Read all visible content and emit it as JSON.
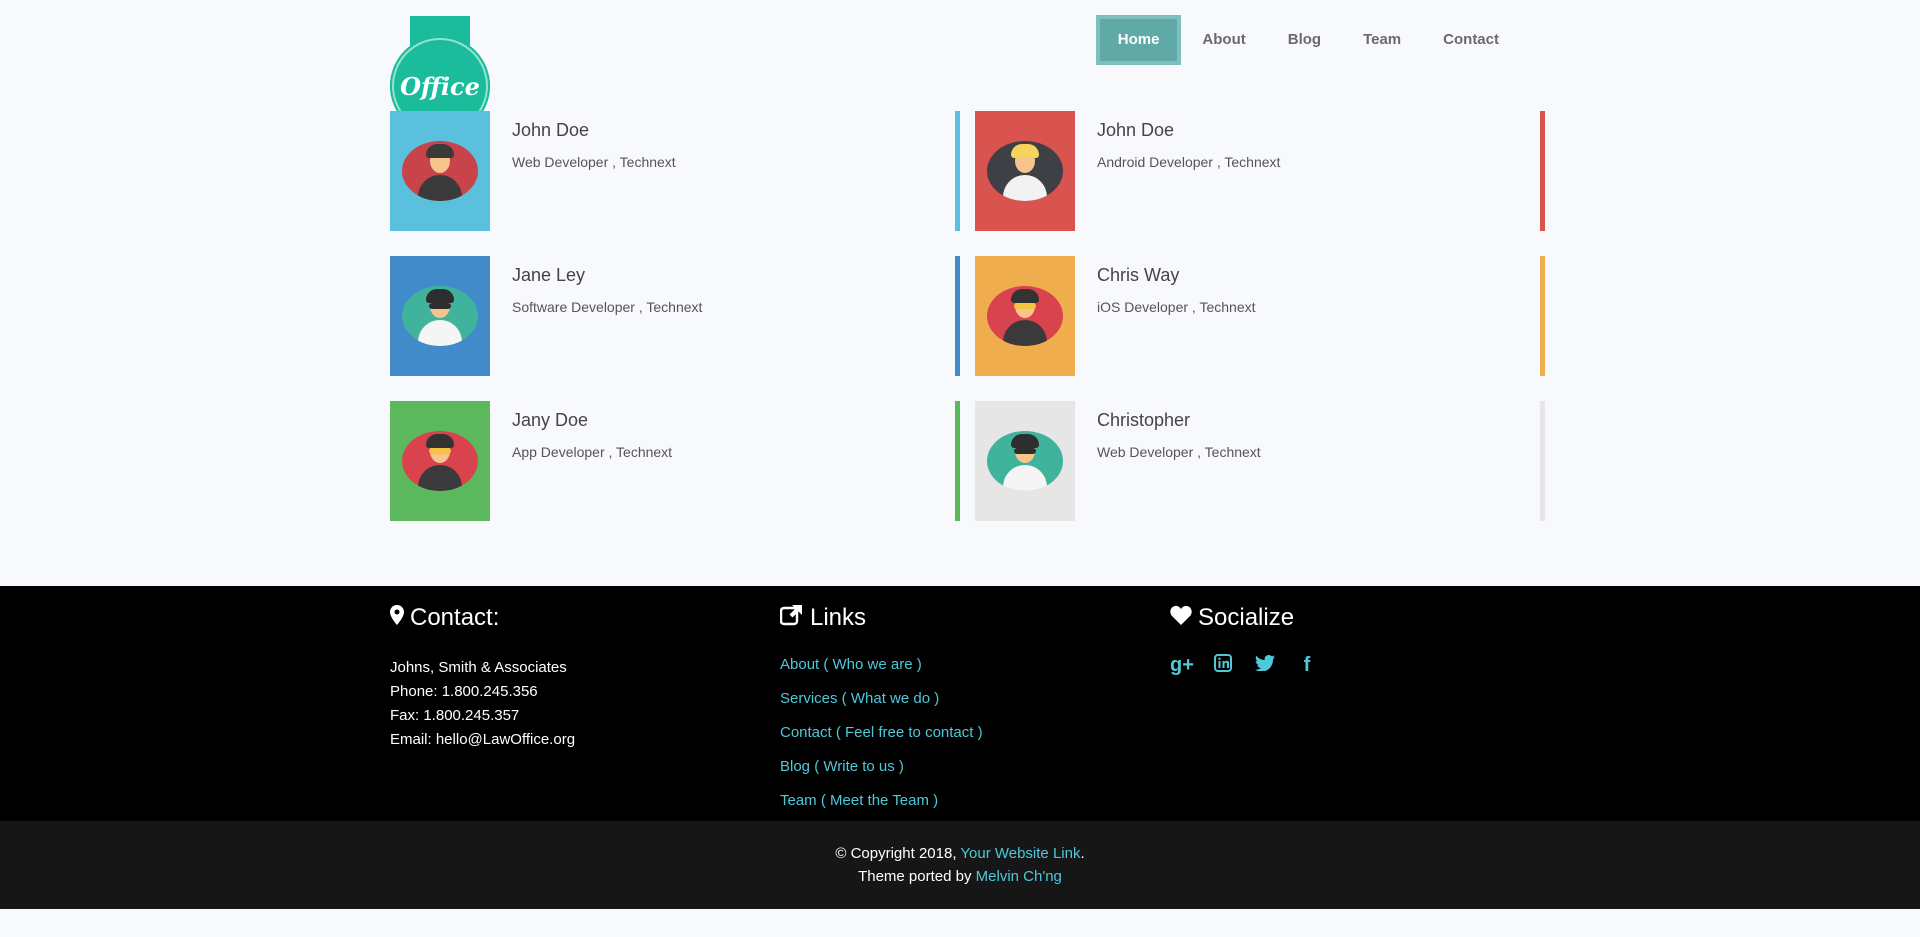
{
  "logo": {
    "text": "Office"
  },
  "nav": [
    {
      "label": "Home",
      "active": true
    },
    {
      "label": "About"
    },
    {
      "label": "Blog"
    },
    {
      "label": "Team"
    },
    {
      "label": "Contact"
    }
  ],
  "team": [
    {
      "name": "John Doe",
      "role": "Web Developer , Technext",
      "color": "#5bc0de"
    },
    {
      "name": "John Doe",
      "role": "Android Developer , Technext",
      "color": "#d9534f"
    },
    {
      "name": "Jane Ley",
      "role": "Software Developer , Technext",
      "color": "#428bca"
    },
    {
      "name": "Chris Way",
      "role": "iOS Developer , Technext",
      "color": "#f0ad4e"
    },
    {
      "name": "Jany Doe",
      "role": "App Developer , Technext",
      "color": "#5cb85c"
    },
    {
      "name": "Christopher",
      "role": "Web Developer , Technext",
      "color": "#e6e6e6"
    }
  ],
  "footer": {
    "contact": {
      "title": "Contact:",
      "icon": "map-marker-icon",
      "lines": [
        "Johns, Smith & Associates",
        "Phone: 1.800.245.356",
        "Fax: 1.800.245.357",
        "Email: hello@LawOffice.org"
      ]
    },
    "links": {
      "title": "Links",
      "icon": "external-link-icon",
      "items": [
        "About ( Who we are )",
        "Services ( What we do )",
        "Contact ( Feel free to contact )",
        "Blog ( Write to us )",
        "Team ( Meet the Team )"
      ]
    },
    "socialize": {
      "title": "Socialize",
      "icon": "heart-icon",
      "items": [
        "google-plus-icon",
        "linkedin-icon",
        "twitter-icon",
        "facebook-icon"
      ]
    }
  },
  "bottom": {
    "copyright_prefix": "© Copyright 2018,",
    "website_link": "Your Website Link",
    "period": ".",
    "ported_prefix": "Theme ported by",
    "author": "Melvin Ch'ng"
  },
  "colors": {
    "accent": "#1abc9c",
    "link": "#4fc8d8",
    "nav_active": "#5fa9a6"
  }
}
